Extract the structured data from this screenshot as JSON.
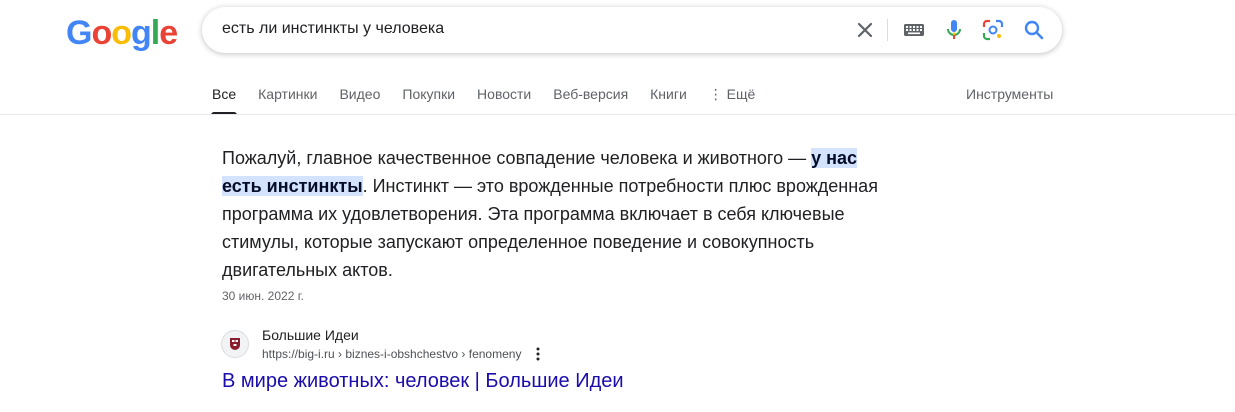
{
  "logo": {
    "letters": [
      "G",
      "o",
      "o",
      "g",
      "l",
      "e"
    ],
    "colors": [
      "#4285f4",
      "#ea4335",
      "#fbbc05",
      "#4285f4",
      "#34a853",
      "#ea4335"
    ]
  },
  "search": {
    "query": "есть ли инстинкты у человека"
  },
  "icons": {
    "clear": "close-icon",
    "keyboard": "keyboard-icon",
    "voice": "microphone-icon",
    "lens": "camera-lens-icon",
    "search": "search-icon",
    "more": "more-vertical-icon"
  },
  "tabs": [
    {
      "label": "Все",
      "active": true
    },
    {
      "label": "Картинки"
    },
    {
      "label": "Видео"
    },
    {
      "label": "Покупки"
    },
    {
      "label": "Новости"
    },
    {
      "label": "Веб-версия"
    },
    {
      "label": "Книги"
    },
    {
      "label": "⋮ Ещё"
    }
  ],
  "tools_label": "Инструменты",
  "featured": {
    "text_before": "Пожалуй, главное качественное совпадение человека и животного — ",
    "highlight": "у нас есть инстинкты",
    "text_after": ". Инстинкт — это врожденные потребности плюс врожденная программа их удовлетворения. Эта программа включает в себя ключевые стимулы, которые запускают определенное поведение и совокупность двигательных актов.",
    "date": "30 июн. 2022 г."
  },
  "result": {
    "site_name": "Большие Идеи",
    "url": "https://big-i.ru › biznes-i-obshchestvo › fenomeny",
    "title": "В мире животных: человек | Большие Идеи"
  },
  "colors": {
    "link": "#1a0dab",
    "highlight_bg": "#d3e3fd"
  }
}
